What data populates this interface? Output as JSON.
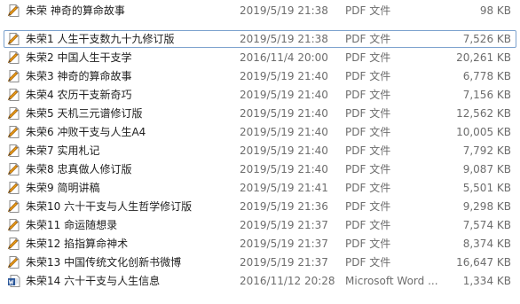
{
  "colors": {
    "selection_border": "#7da2ce",
    "name_text": "#1e1e1e",
    "detail_text": "#6d6d6d",
    "pdf_icon_accent": "#f2a31a",
    "word_icon_accent": "#2b579a"
  },
  "files": [
    {
      "icon": "pdf-document-icon",
      "name": "朱荣 神奇的算命故事",
      "date": "2019/5/19 21:38",
      "type": "PDF 文件",
      "size": "98 KB",
      "selected": false
    },
    {
      "icon": "pdf-document-icon",
      "name": "朱荣1 人生干支数九十九修订版",
      "date": "2019/5/19 21:38",
      "type": "PDF 文件",
      "size": "7,526 KB",
      "selected": true
    },
    {
      "icon": "pdf-document-icon",
      "name": "朱荣2 中国人生干支学",
      "date": "2016/11/4 20:00",
      "type": "PDF 文件",
      "size": "20,261 KB",
      "selected": false
    },
    {
      "icon": "pdf-document-icon",
      "name": "朱荣3 神奇的算命故事",
      "date": "2019/5/19 21:40",
      "type": "PDF 文件",
      "size": "6,778 KB",
      "selected": false
    },
    {
      "icon": "pdf-document-icon",
      "name": "朱荣4 农历干支新奇巧",
      "date": "2019/5/19 21:40",
      "type": "PDF 文件",
      "size": "7,156 KB",
      "selected": false
    },
    {
      "icon": "pdf-document-icon",
      "name": "朱荣5 天机三元谱修订版",
      "date": "2019/5/19 21:40",
      "type": "PDF 文件",
      "size": "12,562 KB",
      "selected": false
    },
    {
      "icon": "pdf-document-icon",
      "name": "朱荣6 冲败干支与人生A4",
      "date": "2019/5/19 21:40",
      "type": "PDF 文件",
      "size": "10,005 KB",
      "selected": false
    },
    {
      "icon": "pdf-document-icon",
      "name": "朱荣7 实用札记",
      "date": "2019/5/19 21:40",
      "type": "PDF 文件",
      "size": "7,792 KB",
      "selected": false
    },
    {
      "icon": "pdf-document-icon",
      "name": "朱荣8 忠真做人修订版",
      "date": "2019/5/19 21:40",
      "type": "PDF 文件",
      "size": "9,087 KB",
      "selected": false
    },
    {
      "icon": "pdf-document-icon",
      "name": "朱荣9 简明讲稿",
      "date": "2019/5/19 21:41",
      "type": "PDF 文件",
      "size": "5,501 KB",
      "selected": false
    },
    {
      "icon": "pdf-document-icon",
      "name": "朱荣10 六十干支与人生哲学修订版",
      "date": "2019/5/19 21:36",
      "type": "PDF 文件",
      "size": "9,298 KB",
      "selected": false
    },
    {
      "icon": "pdf-document-icon",
      "name": "朱荣11 命运随想录",
      "date": "2019/5/19 21:37",
      "type": "PDF 文件",
      "size": "7,574 KB",
      "selected": false
    },
    {
      "icon": "pdf-document-icon",
      "name": "朱荣12 掐指算命神术",
      "date": "2019/5/19 21:37",
      "type": "PDF 文件",
      "size": "8,374 KB",
      "selected": false
    },
    {
      "icon": "pdf-document-icon",
      "name": "朱荣13 中国传统文化创新书微博",
      "date": "2019/5/19 21:37",
      "type": "PDF 文件",
      "size": "16,647 KB",
      "selected": false
    },
    {
      "icon": "word-document-icon",
      "name": "朱荣14 六十干支与人生信息",
      "date": "2016/11/12 20:28",
      "type": "Microsoft Word ...",
      "size": "1,334 KB",
      "selected": false
    }
  ]
}
